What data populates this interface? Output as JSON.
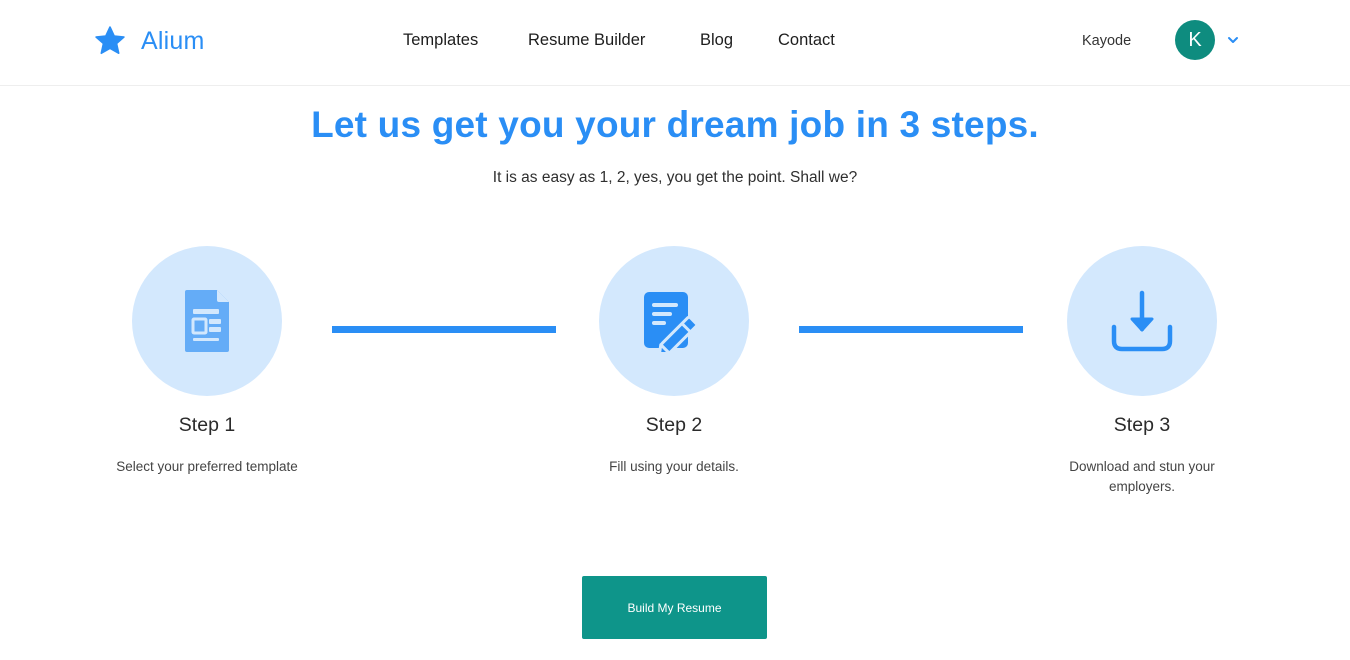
{
  "brand": {
    "name": "Alium",
    "color": "#2a8ef5",
    "icon": "star-icon"
  },
  "nav": {
    "links": [
      "Templates",
      "Resume Builder",
      "Blog",
      "Contact"
    ]
  },
  "user": {
    "name": "Kayode",
    "initial": "K",
    "avatar_color": "#0e8c7f",
    "menu_icon": "chevron-down-icon"
  },
  "hero": {
    "headline": "Let us get you your dream job in 3 steps.",
    "subline": "It is as easy as 1, 2, yes, you get the point. Shall we?"
  },
  "steps": [
    {
      "title": "Step 1",
      "description": "Select your preferred template",
      "icon": "template-document-icon"
    },
    {
      "title": "Step 2",
      "description": "Fill using your details.",
      "icon": "edit-document-icon"
    },
    {
      "title": "Step 3",
      "description": "Download and stun your employers.",
      "icon": "download-icon"
    }
  ],
  "cta": {
    "label": "Build My Resume",
    "color": "#0e958a"
  },
  "colors": {
    "accent": "#2a8ef5",
    "circle_bg": "#d3e8fd"
  }
}
